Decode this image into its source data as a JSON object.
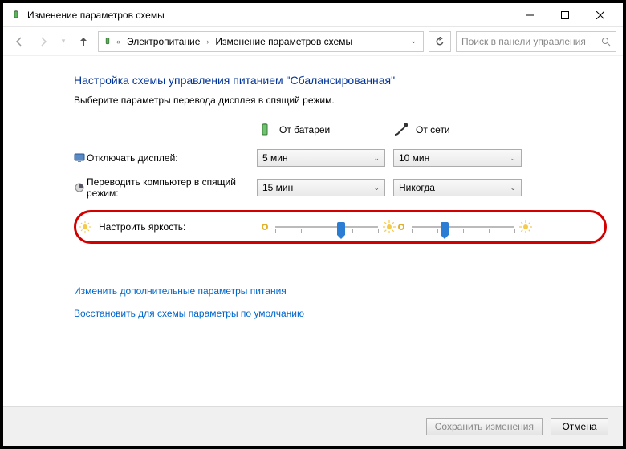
{
  "window": {
    "title": "Изменение параметров схемы"
  },
  "breadcrumb": {
    "root": "Электропитание",
    "current": "Изменение параметров схемы"
  },
  "search": {
    "placeholder": "Поиск в панели управления"
  },
  "heading": "Настройка схемы управления питанием \"Сбалансированная\"",
  "subheading": "Выберите параметры перевода дисплея в спящий режим.",
  "modes": {
    "battery": "От батареи",
    "plugged": "От сети"
  },
  "rows": {
    "display_off": {
      "label": "Отключать дисплей:",
      "battery": "5 мин",
      "plugged": "10 мин"
    },
    "sleep": {
      "label": "Переводить компьютер в спящий режим:",
      "battery": "15 мин",
      "plugged": "Никогда"
    },
    "brightness": {
      "label": "Настроить яркость:"
    }
  },
  "links": {
    "advanced": "Изменить дополнительные параметры питания",
    "restore": "Восстановить для схемы параметры по умолчанию"
  },
  "buttons": {
    "save": "Сохранить изменения",
    "cancel": "Отмена"
  }
}
